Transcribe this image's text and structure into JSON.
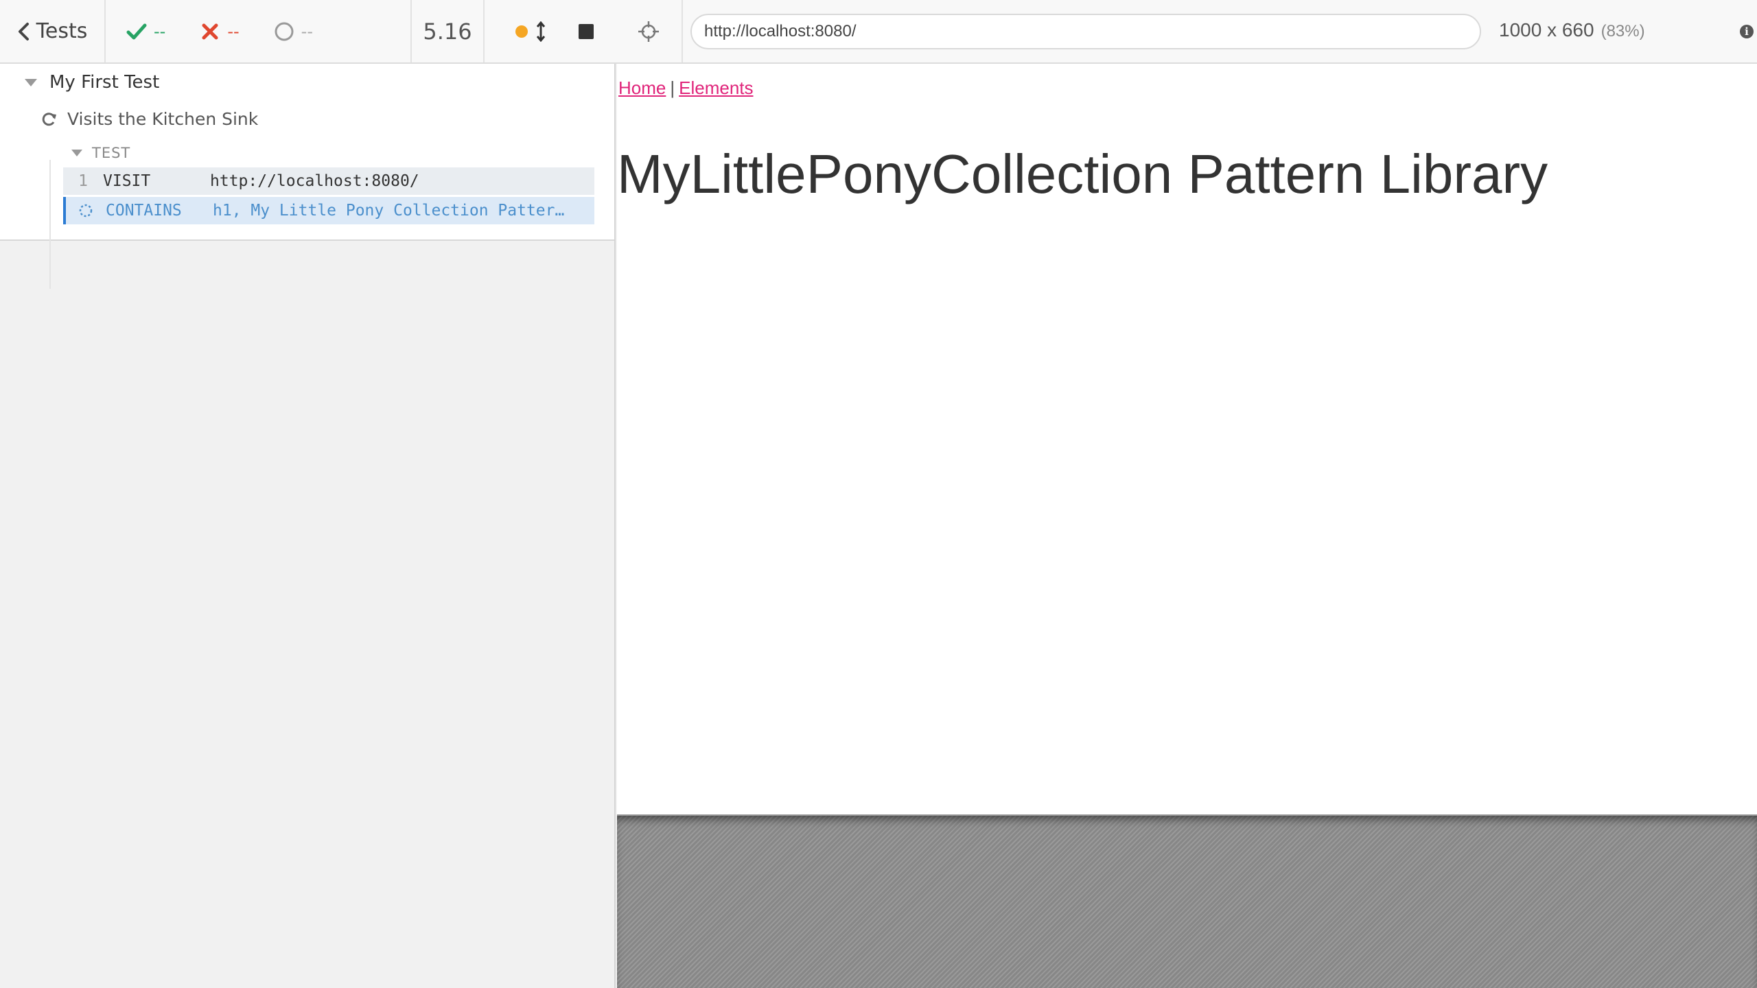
{
  "reporter": {
    "back_label": "Tests",
    "stats": {
      "passed": "--",
      "failed": "--",
      "pending": "--"
    },
    "duration": "5.16",
    "suite_title": "My First Test",
    "test_title": "Visits the Kitchen Sink",
    "group_label": "TEST",
    "commands": [
      {
        "number": "1",
        "name": "VISIT",
        "message": "http://localhost:8080/"
      },
      {
        "number": "",
        "name": "CONTAINS",
        "message": "h1, My Little Pony Collection Patter…"
      }
    ]
  },
  "aut": {
    "url": "http://localhost:8080/",
    "viewport_size": "1000 x 660",
    "viewport_scale": "(83%)",
    "info_glyph": "i",
    "nav": {
      "home": "Home",
      "separator": "|",
      "elements": "Elements"
    },
    "heading": "MyLittlePonyCollection Pattern Library"
  },
  "colors": {
    "pass": "#27a364",
    "fail": "#e0472f",
    "running_dot": "#f5a623",
    "link": "#e0247a",
    "active_command": "#2b7bd3"
  },
  "icons": [
    "chevron-left-icon",
    "check-icon",
    "x-icon",
    "circle-icon",
    "resize-arrow-icon",
    "stop-icon",
    "refresh-icon",
    "spinner-icon",
    "crosshair-icon",
    "info-icon"
  ]
}
